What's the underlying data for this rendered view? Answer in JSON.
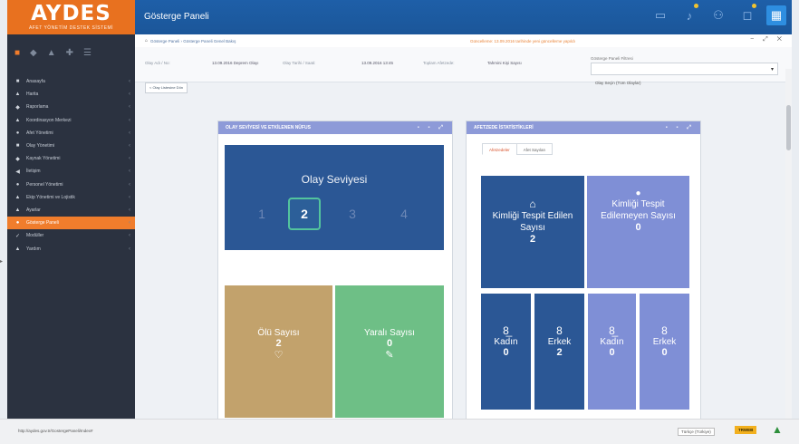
{
  "brand": {
    "logo_text": "AYDES",
    "logo_sub": "AFET YÖNETİM DESTEK SİSTEMİ"
  },
  "header": {
    "title": "Gösterge Paneli"
  },
  "topbar_icons": [
    "monitor-icon",
    "bell-icon",
    "user-icon",
    "notification-icon",
    "grid-icon"
  ],
  "sidebar": {
    "quick_icons": [
      "home-icon",
      "chart-icon",
      "users-icon",
      "settings-icon",
      "list-icon"
    ],
    "items": [
      {
        "label": "Anasayfa",
        "icon": "■"
      },
      {
        "label": "Harita",
        "icon": "▲"
      },
      {
        "label": "Raporlama",
        "icon": "◆"
      },
      {
        "label": "Koordinasyon Merkezi",
        "icon": "▲"
      },
      {
        "label": "Afet Yönetimi",
        "icon": "●"
      },
      {
        "label": "Olay Yönetimi",
        "icon": "■"
      },
      {
        "label": "Kaynak Yönetimi",
        "icon": "◆"
      },
      {
        "label": "İletişim",
        "icon": "◀"
      },
      {
        "label": "Personel Yönetimi",
        "icon": "●"
      },
      {
        "label": "Ekip Yönetimi ve Lojistik",
        "icon": "▲"
      },
      {
        "label": "Ayarlar",
        "icon": "▲"
      },
      {
        "label": "Gösterge Paneli",
        "icon": "●",
        "active": true
      },
      {
        "label": "Modüller",
        "icon": "✓"
      },
      {
        "label": "Yardım",
        "icon": "▲"
      }
    ]
  },
  "breadcrumb": {
    "path": "Gösterge Paneli › Gösterge Paneli Genel Bakış",
    "warning": "Güncelleme: 13.09.2016 tarihinde yeni güncelleme yapıldı",
    "controls": "− ⤢ ✕"
  },
  "info": {
    "event_label": "Olay Adı / No:",
    "event_value": "13.09.2016 Deprem Olayı",
    "date_label": "Olay Tarihi / Saati:",
    "date_value": "13.09.2016 13:45",
    "total_label": "Toplam Afetzede:",
    "total_value": "Tahmini Kişi Sayısı",
    "dropdown_label": "Gösterge Paneli Filtresi",
    "dropdown_value": "Olay Seçin (Tüm Olaylar)"
  },
  "return_button": "< Olay Listesine Dön",
  "left_panel": {
    "title": "OLAY SEVİYESİ VE ETKİLENEN NÜFUS",
    "olay_title": "Olay Seviyesi",
    "levels": [
      "1",
      "2",
      "3",
      "4"
    ],
    "selected_level": "2",
    "dead_label": "Ölü Sayısı",
    "dead_value": "2",
    "injured_label": "Yaralı Sayısı",
    "injured_value": "0"
  },
  "right_panel": {
    "title": "AFETZEDE İSTATİSTİKLERİ",
    "tabs": [
      "Afetzedeler",
      "Afet Sayıları"
    ],
    "identified_label": "Kimliği Tespit Edilen Sayısı",
    "identified_value": "2",
    "unidentified_label": "Kimliği Tespit Edilemeyen Sayısı",
    "unidentified_value": "0",
    "stats": [
      {
        "label": "Kadın",
        "value": "0",
        "icon": "8̲"
      },
      {
        "label": "Erkek",
        "value": "2",
        "icon": "8"
      },
      {
        "label": "Kadın",
        "value": "0",
        "icon": "8̲"
      },
      {
        "label": "Erkek",
        "value": "0",
        "icon": "8"
      }
    ]
  },
  "statusbar": {
    "url": "http://aydes.gov.tr/GostergePaneli/Index#",
    "language": "Türkçe (Türkiye)",
    "badge": "TRWEB"
  },
  "colors": {
    "brand_orange": "#e8711f",
    "topbar_blue": "#1b5699",
    "sidebar": "#2b3240",
    "panel_header": "#8d9ad8",
    "tile_dark_blue": "#2b5795",
    "tile_tan": "#c2a26c",
    "tile_green": "#6ebf86",
    "tile_lilac": "#7f8fd6"
  }
}
